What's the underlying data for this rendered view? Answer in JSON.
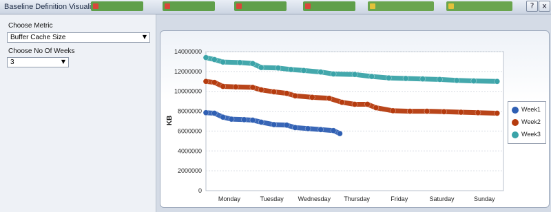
{
  "window": {
    "title": "Baseline Definition Visualizer"
  },
  "titlebar_buttons": {
    "help": "?",
    "close": "x"
  },
  "controls": {
    "metric_label": "Choose Metric",
    "metric_value": "Buffer Cache Size",
    "weeks_label": "Choose No Of Weeks",
    "weeks_value": "3"
  },
  "chart_data": {
    "type": "scatter",
    "ylabel": "KB",
    "ylim": [
      0,
      14000000
    ],
    "yticks": [
      "0",
      "2000000",
      "4000000",
      "6000000",
      "8000000",
      "10000000",
      "12000000",
      "14000000"
    ],
    "xticks": [
      "Monday",
      "Tuesday",
      "Wednesday",
      "Thursday",
      "Friday",
      "Saturday",
      "Sunday"
    ],
    "xlim": [
      0,
      7
    ],
    "grid": true,
    "legend_position": "right",
    "series": [
      {
        "name": "Week1",
        "color": "#2f5fb3",
        "points": [
          [
            0,
            7850000
          ],
          [
            0.2,
            7800000
          ],
          [
            0.4,
            7400000
          ],
          [
            0.6,
            7200000
          ],
          [
            0.9,
            7150000
          ],
          [
            1.1,
            7100000
          ],
          [
            1.3,
            6900000
          ],
          [
            1.6,
            6650000
          ],
          [
            1.9,
            6600000
          ],
          [
            2.1,
            6350000
          ],
          [
            2.4,
            6250000
          ],
          [
            2.7,
            6150000
          ],
          [
            3.0,
            6050000
          ],
          [
            3.15,
            5750000
          ]
        ]
      },
      {
        "name": "Week2",
        "color": "#b53b0e",
        "points": [
          [
            0,
            11000000
          ],
          [
            0.2,
            10900000
          ],
          [
            0.4,
            10500000
          ],
          [
            0.7,
            10450000
          ],
          [
            1.1,
            10400000
          ],
          [
            1.3,
            10150000
          ],
          [
            1.6,
            9950000
          ],
          [
            1.9,
            9800000
          ],
          [
            2.1,
            9550000
          ],
          [
            2.5,
            9400000
          ],
          [
            2.9,
            9300000
          ],
          [
            3.2,
            8900000
          ],
          [
            3.5,
            8700000
          ],
          [
            3.8,
            8700000
          ],
          [
            4.0,
            8350000
          ],
          [
            4.4,
            8050000
          ],
          [
            4.8,
            8000000
          ],
          [
            5.2,
            8000000
          ],
          [
            5.6,
            7950000
          ],
          [
            6.0,
            7900000
          ],
          [
            6.4,
            7850000
          ],
          [
            6.85,
            7800000
          ]
        ]
      },
      {
        "name": "Week3",
        "color": "#3aa3a8",
        "points": [
          [
            0,
            13400000
          ],
          [
            0.2,
            13200000
          ],
          [
            0.4,
            12950000
          ],
          [
            0.8,
            12900000
          ],
          [
            1.1,
            12800000
          ],
          [
            1.3,
            12400000
          ],
          [
            1.7,
            12350000
          ],
          [
            2.0,
            12200000
          ],
          [
            2.3,
            12100000
          ],
          [
            2.7,
            11950000
          ],
          [
            3.0,
            11750000
          ],
          [
            3.5,
            11700000
          ],
          [
            3.9,
            11500000
          ],
          [
            4.3,
            11350000
          ],
          [
            4.7,
            11300000
          ],
          [
            5.1,
            11250000
          ],
          [
            5.5,
            11200000
          ],
          [
            5.9,
            11100000
          ],
          [
            6.3,
            11050000
          ],
          [
            6.85,
            11000000
          ]
        ]
      }
    ]
  }
}
